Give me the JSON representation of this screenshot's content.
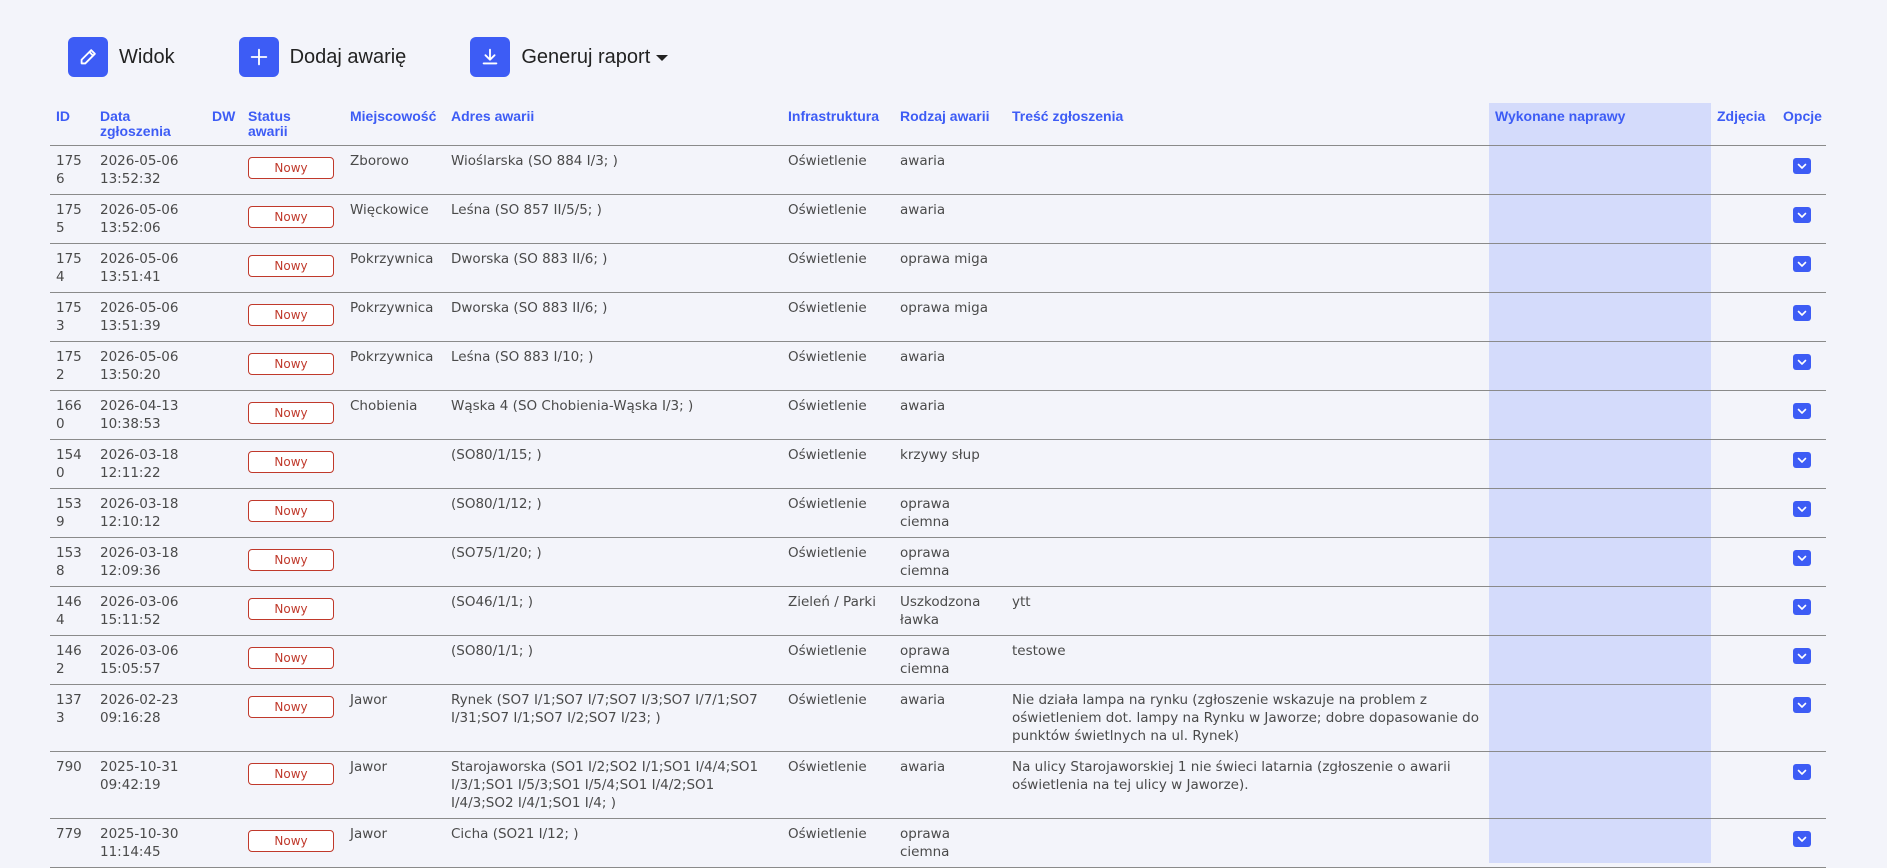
{
  "toolbar": {
    "view_label": "Widok",
    "add_label": "Dodaj awarię",
    "report_label": "Generuj raport",
    "accent": "#3d5cf5"
  },
  "table": {
    "headers": {
      "id": "ID",
      "date_l1": "Data",
      "date_l2": "zgłoszenia",
      "dw": "DW",
      "status_l1": "Status",
      "status_l2": "awarii",
      "town": "Miejscowość",
      "address": "Adres awarii",
      "infra": "Infrastruktura",
      "type": "Rodzaj awarii",
      "content": "Treść zgłoszenia",
      "repairs": "Wykonane naprawy",
      "photos": "Zdjęcia",
      "options": "Opcje"
    },
    "rows": [
      {
        "id": "1756",
        "date": "2026-05-06",
        "time": "13:52:32",
        "dw": "",
        "status": "Nowy",
        "town": "Zborowo",
        "address": "Wioślarska (SO 884 I/3; )",
        "infra": "Oświetlenie",
        "type": "awaria",
        "content": "",
        "repairs": "",
        "photos": ""
      },
      {
        "id": "1755",
        "date": "2026-05-06",
        "time": "13:52:06",
        "dw": "",
        "status": "Nowy",
        "town": "Więckowice",
        "address": "Leśna (SO 857 II/5/5; )",
        "infra": "Oświetlenie",
        "type": "awaria",
        "content": "",
        "repairs": "",
        "photos": ""
      },
      {
        "id": "1754",
        "date": "2026-05-06",
        "time": "13:51:41",
        "dw": "",
        "status": "Nowy",
        "town": "Pokrzywnica",
        "address": "Dworska (SO 883 II/6; )",
        "infra": "Oświetlenie",
        "type": "oprawa miga",
        "content": "",
        "repairs": "",
        "photos": ""
      },
      {
        "id": "1753",
        "date": "2026-05-06",
        "time": "13:51:39",
        "dw": "",
        "status": "Nowy",
        "town": "Pokrzywnica",
        "address": "Dworska (SO 883 II/6; )",
        "infra": "Oświetlenie",
        "type": "oprawa miga",
        "content": "",
        "repairs": "",
        "photos": ""
      },
      {
        "id": "1752",
        "date": "2026-05-06",
        "time": "13:50:20",
        "dw": "",
        "status": "Nowy",
        "town": "Pokrzywnica",
        "address": "Leśna (SO 883 I/10; )",
        "infra": "Oświetlenie",
        "type": "awaria",
        "content": "",
        "repairs": "",
        "photos": ""
      },
      {
        "id": "1660",
        "date": "2026-04-13",
        "time": "10:38:53",
        "dw": "",
        "status": "Nowy",
        "town": "Chobienia",
        "address": "Wąska 4 (SO Chobienia-Wąska I/3; )",
        "infra": "Oświetlenie",
        "type": "awaria",
        "content": "",
        "repairs": "",
        "photos": ""
      },
      {
        "id": "1540",
        "date": "2026-03-18",
        "time": "12:11:22",
        "dw": "",
        "status": "Nowy",
        "town": "",
        "address": "(SO80/1/15; )",
        "infra": "Oświetlenie",
        "type": "krzywy słup",
        "content": "",
        "repairs": "",
        "photos": ""
      },
      {
        "id": "1539",
        "date": "2026-03-18",
        "time": "12:10:12",
        "dw": "",
        "status": "Nowy",
        "town": "",
        "address": "(SO80/1/12; )",
        "infra": "Oświetlenie",
        "type": "oprawa ciemna",
        "content": "",
        "repairs": "",
        "photos": ""
      },
      {
        "id": "1538",
        "date": "2026-03-18",
        "time": "12:09:36",
        "dw": "",
        "status": "Nowy",
        "town": "",
        "address": "(SO75/1/20; )",
        "infra": "Oświetlenie",
        "type": "oprawa ciemna",
        "content": "",
        "repairs": "",
        "photos": ""
      },
      {
        "id": "1464",
        "date": "2026-03-06",
        "time": "15:11:52",
        "dw": "",
        "status": "Nowy",
        "town": "",
        "address": "(SO46/1/1; )",
        "infra": "Zieleń / Parki",
        "type": "Uszkodzona ławka",
        "content": "ytt",
        "repairs": "",
        "photos": ""
      },
      {
        "id": "1462",
        "date": "2026-03-06",
        "time": "15:05:57",
        "dw": "",
        "status": "Nowy",
        "town": "",
        "address": "(SO80/1/1; )",
        "infra": "Oświetlenie",
        "type": "oprawa ciemna",
        "content": "testowe",
        "repairs": "",
        "photos": ""
      },
      {
        "id": "1373",
        "date": "2026-02-23",
        "time": "09:16:28",
        "dw": "",
        "status": "Nowy",
        "town": "Jawor",
        "address": "Rynek (SO7 I/1;SO7 I/7;SO7 I/3;SO7 I/7/1;SO7 I/31;SO7 I/1;SO7 I/2;SO7 I/23; )",
        "infra": "Oświetlenie",
        "type": "awaria",
        "content": "Nie działa lampa na rynku (zgłoszenie wskazuje na problem z oświetleniem dot. lampy na Rynku w Jaworze; dobre dopasowanie do punktów świetlnych na ul. Rynek)",
        "repairs": "",
        "photos": ""
      },
      {
        "id": "790",
        "date": "2025-10-31",
        "time": "09:42:19",
        "dw": "",
        "status": "Nowy",
        "town": "Jawor",
        "address": "Starojaworska (SO1 I/2;SO2 I/1;SO1 I/4/4;SO1 I/3/1;SO1 I/5/3;SO1 I/5/4;SO1 I/4/2;SO1 I/4/3;SO2 I/4/1;SO1 I/4; )",
        "infra": "Oświetlenie",
        "type": "awaria",
        "content": "Na ulicy Starojaworskiej 1 nie świeci latarnia (zgłoszenie o awarii oświetlenia na tej ulicy w Jaworze).",
        "repairs": "",
        "photos": ""
      },
      {
        "id": "779",
        "date": "2025-10-30",
        "time": "11:14:45",
        "dw": "",
        "status": "Nowy",
        "town": "Jawor",
        "address": "Cicha (SO21 I/12; )",
        "infra": "Oświetlenie",
        "type": "oprawa ciemna",
        "content": "",
        "repairs": "",
        "photos": ""
      }
    ]
  }
}
